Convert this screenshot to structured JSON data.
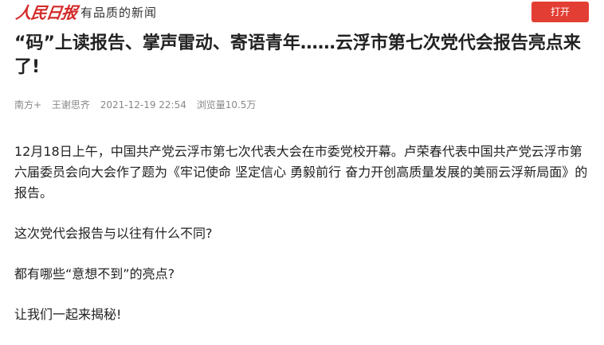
{
  "header": {
    "logo_text": "人民日报",
    "slogan": "有品质的新闻",
    "open_button_label": "打开"
  },
  "article": {
    "title": "“码”上读报告、掌声雷动、寄语青年……云浮市第七次党代会报告亮点来了!",
    "meta": {
      "source": "南方+",
      "author": "王谢思齐",
      "datetime": "2021-12-19 22:54",
      "views": "浏览量10.5万"
    },
    "paragraphs": [
      "12月18日上午，中国共产党云浮市第七次代表大会在市委党校开幕。卢荣春代表中国共产党云浮市第六届委员会向大会作了题为《牢记使命 坚定信心 勇毅前行 奋力开创高质量发展的美丽云浮新局面》的报告。",
      "这次党代会报告与以往有什么不同?",
      "都有哪些“意想不到”的亮点?",
      "让我们一起来揭秘!"
    ]
  },
  "colors": {
    "accent": "#e33e33",
    "logo": "#d42a2a",
    "meta_text": "#888888"
  }
}
